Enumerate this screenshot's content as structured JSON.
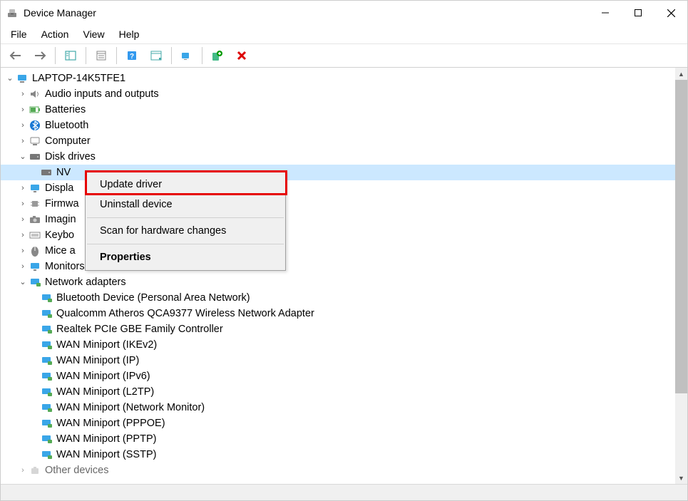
{
  "window_title": "Device Manager",
  "menu": {
    "file": "File",
    "action": "Action",
    "view": "View",
    "help": "Help"
  },
  "root_node": "LAPTOP-14K5TFE1",
  "categories": {
    "audio": "Audio inputs and outputs",
    "batteries": "Batteries",
    "bluetooth": "Bluetooth",
    "computer": "Computer",
    "disk": "Disk drives",
    "disk_selected": "NV",
    "display": "Displa",
    "firmware": "Firmwa",
    "imaging": "Imagin",
    "keyboard": "Keybo",
    "mice": "Mice a",
    "monitors": "Monitors",
    "network": "Network adapters",
    "other": "Other devices"
  },
  "network_items": [
    "Bluetooth Device (Personal Area Network)",
    "Qualcomm Atheros QCA9377 Wireless Network Adapter",
    "Realtek PCIe GBE Family Controller",
    "WAN Miniport (IKEv2)",
    "WAN Miniport (IP)",
    "WAN Miniport (IPv6)",
    "WAN Miniport (L2TP)",
    "WAN Miniport (Network Monitor)",
    "WAN Miniport (PPPOE)",
    "WAN Miniport (PPTP)",
    "WAN Miniport (SSTP)"
  ],
  "context_menu": {
    "update": "Update driver",
    "uninstall": "Uninstall device",
    "scan": "Scan for hardware changes",
    "properties": "Properties"
  }
}
